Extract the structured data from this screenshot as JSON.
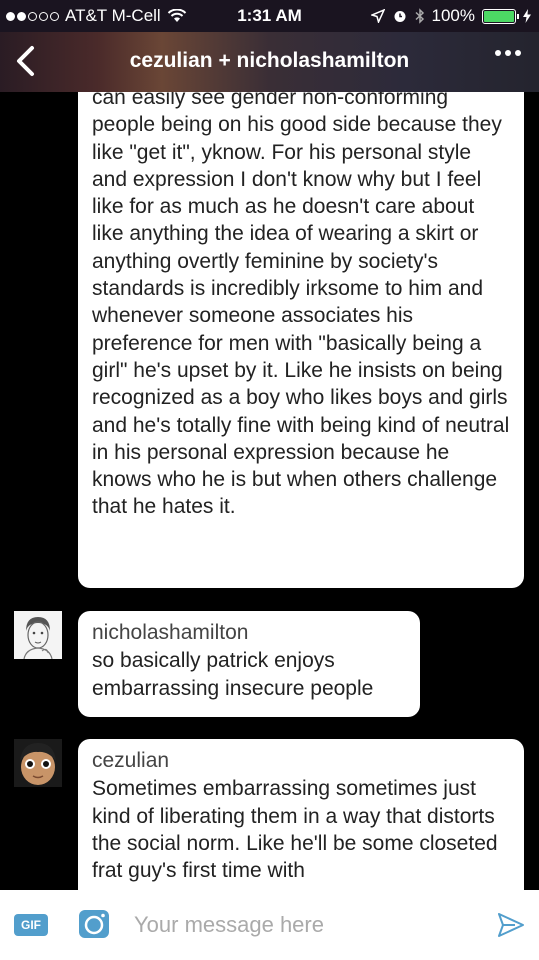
{
  "status_bar": {
    "carrier": "AT&T M-Cell",
    "time": "1:31 AM",
    "battery": "100%"
  },
  "header": {
    "title": "cezulian + nicholashamilton"
  },
  "messages": [
    {
      "text": "can easily see gender non-conforming people being on his good side because they like \"get it\", yknow. For his personal style and expression I don't know why but I feel like for as much as he doesn't care about like anything the idea of wearing a skirt or anything overtly feminine by society's standards is incredibly irksome to him and whenever someone associates his preference for men with \"basically being a girl\" he's upset by it. Like he insists on being recognized as a boy who likes boys and girls and he's totally fine with being kind of neutral in his personal expression because he knows who he is but when others challenge that he hates it."
    },
    {
      "sender": "nicholashamilton",
      "text": "so basically patrick enjoys embarrassing insecure people"
    },
    {
      "sender": "cezulian",
      "text": "Sometimes embarrassing sometimes just kind of liberating them in a way that distorts the social norm. Like he'll be some closeted frat guy's first time with"
    }
  ],
  "composer": {
    "gif_label": "GIF",
    "placeholder": "Your message here"
  },
  "colors": {
    "accent": "#529ecc",
    "battery": "#4cd964"
  }
}
